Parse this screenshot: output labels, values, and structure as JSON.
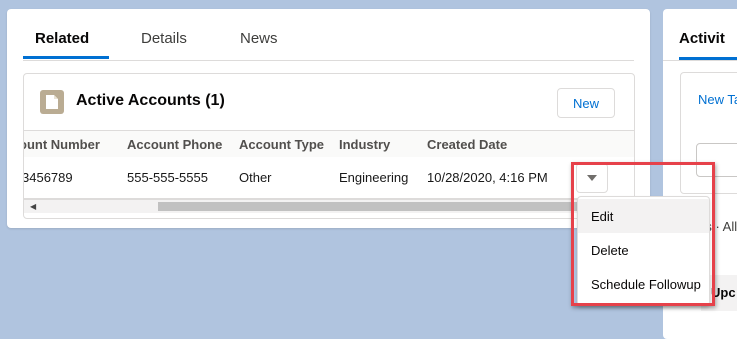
{
  "tabs": [
    {
      "label": "Related",
      "active": true
    },
    {
      "label": "Details",
      "active": false
    },
    {
      "label": "News",
      "active": false
    }
  ],
  "related_list": {
    "title": "Active Accounts (1)",
    "new_button": "New",
    "icon": "document-icon",
    "columns": [
      "ount Number",
      "Account Phone",
      "Account Type",
      "Industry",
      "Created Date"
    ],
    "rows": [
      [
        "3456789",
        "555-555-5555",
        "Other",
        "Engineering",
        "10/28/2020, 4:16 PM"
      ]
    ]
  },
  "row_menu": {
    "items": [
      "Edit",
      "Delete",
      "Schedule Followup"
    ],
    "highlighted": "Edit"
  },
  "right_panel": {
    "tab": "Activit",
    "link": "New Ta",
    "text": "rs · All",
    "strip": "Upc"
  },
  "colors": {
    "accent": "#0070d2",
    "highlight": "#e6414a",
    "background": "#b0c4df",
    "icon_bg": "#baac93"
  }
}
